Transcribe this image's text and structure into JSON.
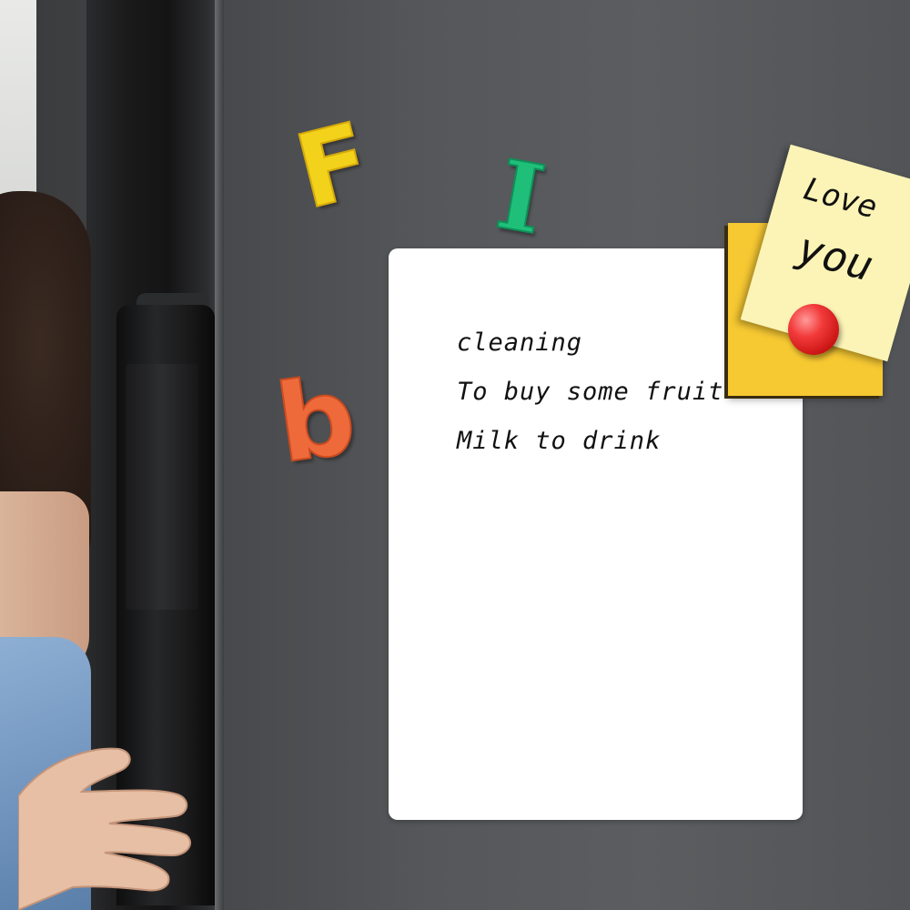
{
  "whiteboard": {
    "lines": [
      "cleaning",
      "To buy some fruit",
      "Milk to drink"
    ]
  },
  "magnet_letters": {
    "f": "F",
    "i": "I",
    "b": "b"
  },
  "sticky_note": {
    "line_1": "Love",
    "line_2": "you"
  },
  "colors": {
    "fridge": "#55575a",
    "letter_f": "#f2d21b",
    "letter_i": "#1fbf7a",
    "letter_b": "#ef6a3a",
    "sticky_back": "#f6c832",
    "sticky_front": "#fbf4b6",
    "push_pin": "#e02626"
  }
}
